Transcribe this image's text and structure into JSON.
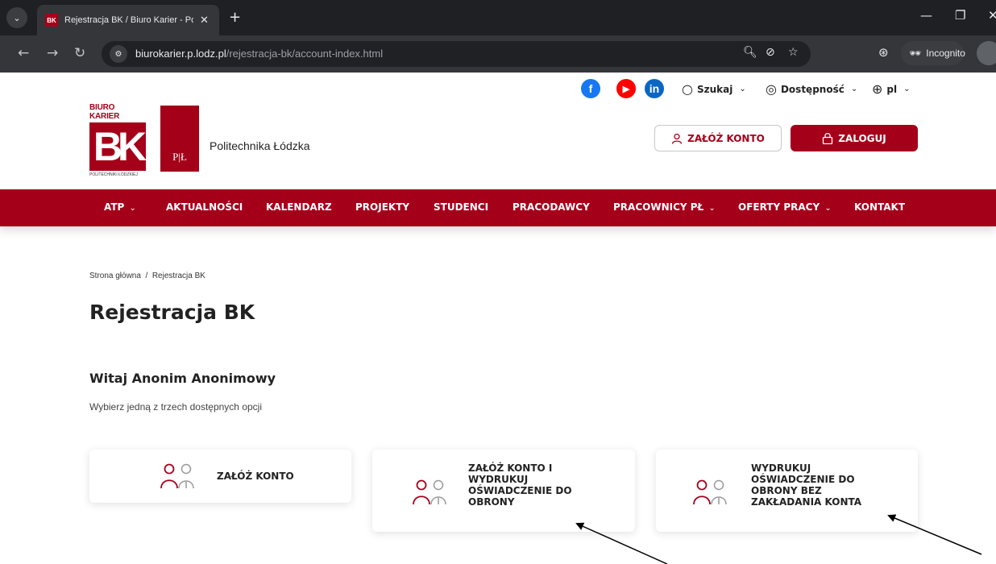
{
  "browser": {
    "tab_title": "Rejestracja BK / Biuro Karier - Po",
    "tab_favicon_text": "BK",
    "url_host": "biurokarier.p.lodz.pl",
    "url_path": "/rejestracja-bk/account-index.html",
    "incognito_label": "Incognito"
  },
  "header": {
    "social": [
      {
        "name": "facebook",
        "glyph": "f",
        "color": "#1877f2"
      },
      {
        "name": "youtube",
        "glyph": "▶",
        "color": "#ff0000"
      },
      {
        "name": "linkedin",
        "glyph": "in",
        "color": "#0a66c2"
      }
    ],
    "search_label": "Szukaj",
    "accessibility_label": "Dostępność",
    "language_label": "pl",
    "logo_top_text": "BIURO KARIER",
    "logo_letters": "BK",
    "logo_bottom_text": "POLITECHNIKI ŁÓDZKIEJ",
    "pl_logo_text": "P|Ł",
    "university_name": "Politechnika Łódzka",
    "create_account_label": "ZAŁÓŻ KONTO",
    "login_label": "ZALOGUJ"
  },
  "nav": {
    "items": [
      {
        "label": "ATP",
        "dropdown": true
      },
      {
        "label": "AKTUALNOŚCI",
        "dropdown": false
      },
      {
        "label": "KALENDARZ",
        "dropdown": false
      },
      {
        "label": "PROJEKTY",
        "dropdown": false
      },
      {
        "label": "STUDENCI",
        "dropdown": false
      },
      {
        "label": "PRACODAWCY",
        "dropdown": false
      },
      {
        "label": "PRACOWNICY PŁ",
        "dropdown": true
      },
      {
        "label": "OFERTY PRACY",
        "dropdown": true
      },
      {
        "label": "KONTAKT",
        "dropdown": false
      }
    ]
  },
  "main": {
    "breadcrumb": "Strona główna  /  Rejestracja BK",
    "title": "Rejestracja BK",
    "welcome": "Witaj Anonim Anonimowy",
    "subtext": "Wybierz jedną z trzech dostępnych opcji",
    "options": [
      {
        "lines": [
          "ZAŁÓŻ KONTO"
        ]
      },
      {
        "lines": [
          "ZAŁÓŻ KONTO I",
          "WYDRUKUJ",
          "OŚWIADCZENIE DO",
          "OBRONY"
        ]
      },
      {
        "lines": [
          "WYDRUKUJ",
          "OŚWIADCZENIE DO",
          "OBRONY BEZ",
          "ZAKŁADANIA KONTA"
        ]
      }
    ]
  },
  "colors": {
    "brand": "#a5001a",
    "browser_dark": "#1f2023",
    "browser_toolbar": "#35363a"
  }
}
